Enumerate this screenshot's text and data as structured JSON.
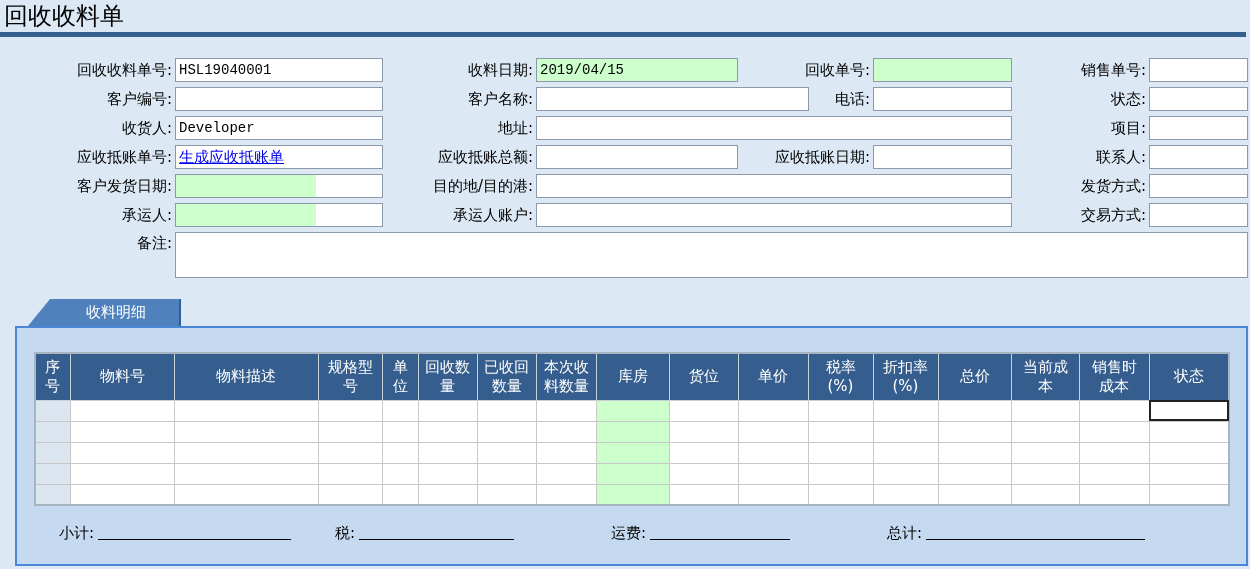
{
  "title": "回收收料单",
  "form": {
    "rows": [
      {
        "fields": [
          {
            "label": "回收收料单号:",
            "value": "HSL19040001"
          },
          {
            "label": "收料日期:",
            "value": "2019/04/15",
            "kind": "highlighted"
          },
          {
            "label": "回收单号:",
            "kind": "highlighted"
          },
          {
            "label": "销售单号:"
          }
        ]
      },
      {
        "fields": [
          {
            "label": "客户编号:"
          },
          {
            "label": "客户名称:"
          },
          {
            "label": "电话:"
          },
          {
            "label": "状态:"
          }
        ]
      },
      {
        "fields": [
          {
            "label": "收货人:",
            "value": "Developer"
          },
          {
            "label": "地址:"
          },
          {
            "label": "项目:"
          }
        ]
      },
      {
        "fields": [
          {
            "label": "应收抵账单号:",
            "link": "生成应收抵账单"
          },
          {
            "label": "应收抵账总额:"
          },
          {
            "label": "应收抵账日期:"
          },
          {
            "label": "联系人:"
          }
        ]
      },
      {
        "fields": [
          {
            "label": "客户发货日期:",
            "kind": "half-highlighted"
          },
          {
            "label": "目的地/目的港:"
          },
          {
            "label": "发货方式:"
          }
        ]
      },
      {
        "fields": [
          {
            "label": "承运人:",
            "kind": "half-highlighted"
          },
          {
            "label": "承运人账户:"
          },
          {
            "label": "交易方式:"
          }
        ]
      },
      {
        "fields": [
          {
            "label": "备注:"
          }
        ]
      }
    ]
  },
  "tab": {
    "label": "收料明细",
    "selected": true
  },
  "table": {
    "columns": [
      {
        "label": "序号",
        "kind": "index"
      },
      {
        "label": "物料号"
      },
      {
        "label": "物料描述"
      },
      {
        "label": "规格型号"
      },
      {
        "label": "单位"
      },
      {
        "label": "回收数量"
      },
      {
        "label": "已收回数量"
      },
      {
        "label": "本次收料数量"
      },
      {
        "label": "库房",
        "kind": "required"
      },
      {
        "label": "货位"
      },
      {
        "label": "单价"
      },
      {
        "label": "税率\n(%)"
      },
      {
        "label": "折扣率\n(%)"
      },
      {
        "label": "总价"
      },
      {
        "label": "当前成本"
      },
      {
        "label": "销售时成本"
      },
      {
        "label": "状态"
      }
    ],
    "rows": [
      {
        "focused": true
      },
      {
        "focused": false
      },
      {
        "focused": false
      },
      {
        "focused": false
      },
      {
        "focused": false
      }
    ]
  },
  "totals": [
    {
      "label": "小计:"
    },
    {
      "label": "税:"
    },
    {
      "label": "运费:"
    },
    {
      "label": "总计:"
    }
  ]
}
